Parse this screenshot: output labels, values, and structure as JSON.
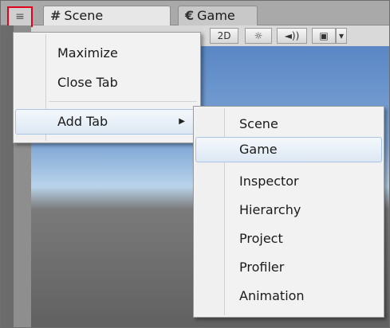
{
  "tabs": {
    "menu_icon": "≡",
    "menu_icon_name": "tab-menu-icon",
    "scene": {
      "glyph": "#",
      "label": "Scene"
    },
    "game": {
      "glyph": "€",
      "label": "Game"
    }
  },
  "toolbar": {
    "mode_2d": "2D",
    "lighting_icon": "☼",
    "audio_icon": "◄))",
    "fx_icon": "▣",
    "fx_dropdown": "▾"
  },
  "context_menu": {
    "items": [
      "Maximize",
      "Close Tab",
      "Add Tab"
    ],
    "submenu_arrow": "▶"
  },
  "add_tab_submenu": {
    "items": [
      "Scene",
      "Game",
      "Inspector",
      "Hierarchy",
      "Project",
      "Profiler",
      "Animation"
    ],
    "highlighted": "Game"
  },
  "colors": {
    "highlight_border": "#e2001a",
    "menu_background": "#f2f2f2",
    "hover_border": "#a9c4e4"
  }
}
